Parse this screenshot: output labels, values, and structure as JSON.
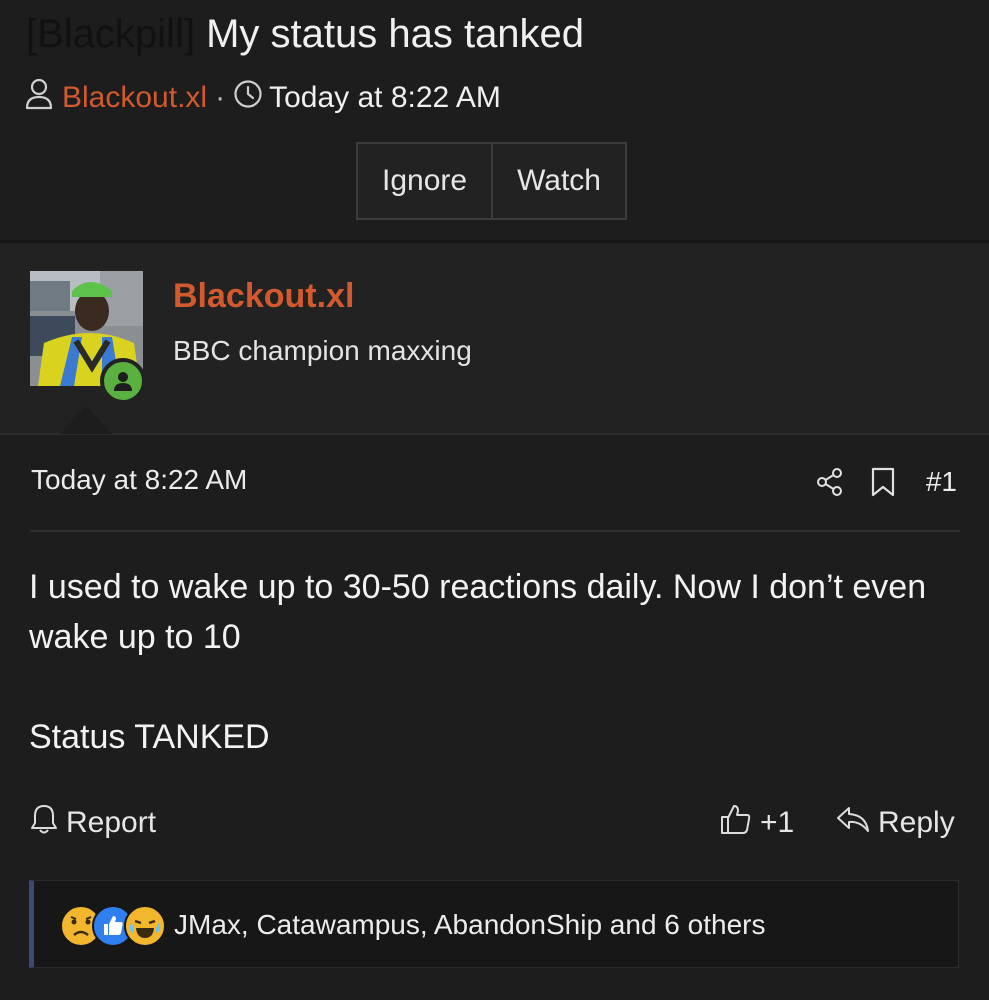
{
  "thread": {
    "prefix": "[Blackpill]",
    "title": "My status has tanked",
    "author": "Blackout.xl",
    "separator": "·",
    "time": "Today at 8:22 AM",
    "buttons": {
      "ignore": "Ignore",
      "watch": "Watch"
    }
  },
  "post": {
    "username": "Blackout.xl",
    "user_title": "BBC champion maxxing",
    "date": "Today at 8:22 AM",
    "number": "#1",
    "paragraphs": [
      "I used to wake up to 30-50 reactions daily. Now I don’t even wake up to 10",
      "Status TANKED"
    ],
    "actions": {
      "report": "Report",
      "like": "+1",
      "reply": "Reply"
    },
    "reactions": {
      "icons": [
        "sad-reaction",
        "like-reaction",
        "laugh-cry-reaction"
      ],
      "text": "JMax, Catawampus, AbandonShip and 6 others"
    }
  },
  "colors": {
    "accent": "#d25a2e",
    "background": "#1d1d1d",
    "online": "#5ab040",
    "reaction_bar_border": "#3a4a7a"
  }
}
